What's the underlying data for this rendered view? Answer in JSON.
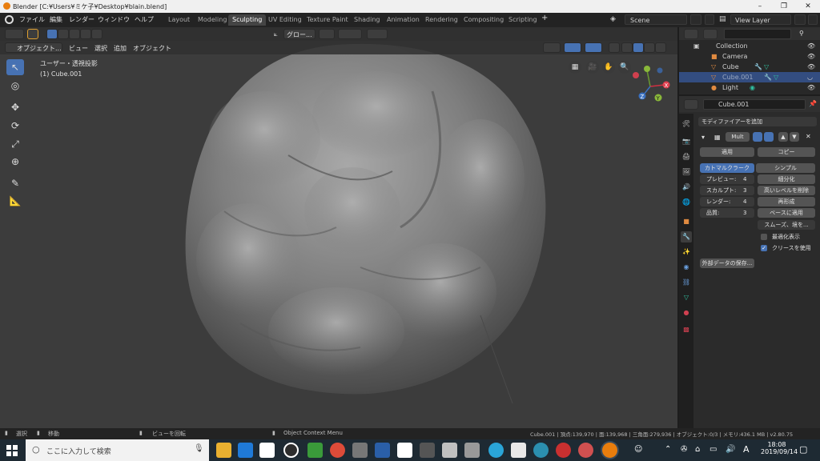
{
  "titlebar": {
    "title": "Blender [C:¥Users¥ミケ子¥Desktop¥blain.blend]",
    "min": "–",
    "max": "❐",
    "close": "✕"
  },
  "menus": [
    "ファイル",
    "編集",
    "レンダー",
    "ウィンドウ",
    "ヘルプ"
  ],
  "workspaces": [
    "Layout",
    "Modeling",
    "Sculpting",
    "UV Editing",
    "Texture Paint",
    "Shading",
    "Animation",
    "Rendering",
    "Compositing",
    "Scripting"
  ],
  "active_workspace": "Sculpting",
  "add_workspace": "+",
  "scene": {
    "name": "Scene",
    "view_layer": "View Layer"
  },
  "viewport": {
    "mode": "オブジェクト...",
    "menus": [
      "ビュー",
      "選択",
      "追加",
      "オブジェクト"
    ],
    "orientation": "グロー...",
    "view_name": "ユーザー・透視投影",
    "object_name": "(1) Cube.001",
    "gizmo": {
      "x": "X",
      "y": "Y",
      "z": "Z"
    }
  },
  "outliner": {
    "rows": [
      {
        "label": "Collection",
        "icon": "collection-icon"
      },
      {
        "label": "Camera",
        "icon": "camera-icon"
      },
      {
        "label": "Cube",
        "icon": "mesh-icon"
      },
      {
        "label": "Cube.001",
        "icon": "mesh-icon",
        "selected": true
      },
      {
        "label": "Light",
        "icon": "light-icon"
      }
    ]
  },
  "properties": {
    "object_name": "Cube.001",
    "add_modifier": "モディファイアーを追加",
    "modifier_name": "Mult",
    "apply": "適用",
    "copy": "コピー",
    "catmull": "カトマルクラーク",
    "simple": "シンプル",
    "fields": [
      {
        "label": "プレビュー:",
        "value": "4"
      },
      {
        "label": "スカルプト:",
        "value": "3"
      },
      {
        "label": "レンダー:",
        "value": "4"
      },
      {
        "label": "品質:",
        "value": "3"
      }
    ],
    "subdivide": "細分化",
    "delete_higher": "高いレベルを削除",
    "reshape": "再形成",
    "apply_base": "ベースに適用",
    "smooth_dropdown": "スムーズ、境を...",
    "optimal_display": "最適化表示",
    "use_creases": "クリースを使用",
    "save_external": "外部データの保存..."
  },
  "statusbar": {
    "select": "選択",
    "move": "移動",
    "rotate_view": "ビューを回転",
    "context_menu": "Object Context Menu",
    "stats": "Cube.001 | 頂点:139,970 | 面:139,968 | 三角面:279,936 | オブジェクト:0/3 | メモリ:436.1 MB | v2.80.75"
  },
  "taskbar": {
    "search_placeholder": "ここに入力して検索",
    "time": "18:08",
    "date": "2019/09/14",
    "ime": "A"
  }
}
